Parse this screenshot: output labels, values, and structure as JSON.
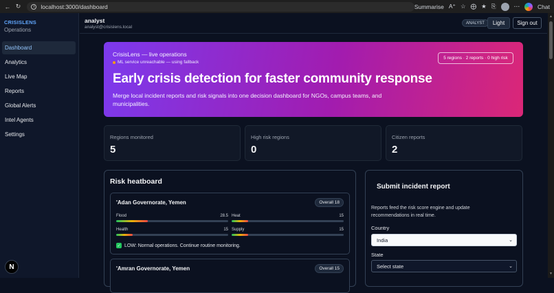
{
  "browser": {
    "url": "localhost:3000/dashboard",
    "summarise_label": "Summarise",
    "chat_label": "Chat"
  },
  "sidebar": {
    "brand": "CRISISLENS",
    "subtitle": "Operations",
    "items": [
      {
        "label": "Dashboard",
        "active": true
      },
      {
        "label": "Analytics"
      },
      {
        "label": "Live Map"
      },
      {
        "label": "Reports"
      },
      {
        "label": "Global Alerts"
      },
      {
        "label": "Intel Agents"
      },
      {
        "label": "Settings"
      }
    ],
    "badge": "N"
  },
  "topbar": {
    "user_name": "analyst",
    "user_email": "analyst@crisislens.local",
    "role": "ANALYST",
    "light_label": "Light",
    "signout_label": "Sign out"
  },
  "hero": {
    "kicker": "CrisisLens — live operations",
    "warning": "ML service unreachable — using fallback",
    "summary": "5 regions · 2 reports · 0 high risk",
    "title": "Early crisis detection for faster community response",
    "description": "Merge local incident reports and risk signals into one decision dashboard for NGOs, campus teams, and municipalities."
  },
  "stats": [
    {
      "label": "Regions monitored",
      "value": "5"
    },
    {
      "label": "High risk regions",
      "value": "0"
    },
    {
      "label": "Citizen reports",
      "value": "2"
    }
  ],
  "heatboard": {
    "title": "Risk heatboard",
    "regions": [
      {
        "name": "'Adan Governorate, Yemen",
        "overall": "Overall 18",
        "metrics": [
          {
            "label": "Flood",
            "value": "28.5",
            "fraction": 0.285
          },
          {
            "label": "Heat",
            "value": "15",
            "fraction": 0.15
          },
          {
            "label": "Health",
            "value": "15",
            "fraction": 0.15
          },
          {
            "label": "Supply",
            "value": "15",
            "fraction": 0.15
          }
        ],
        "status": "LOW: Normal operations. Continue routine monitoring."
      },
      {
        "name": "'Amran Governorate, Yemen",
        "overall": "Overall 15"
      }
    ]
  },
  "form": {
    "title": "Submit incident report",
    "description": "Reports feed the risk score engine and update recommendations in real time.",
    "country_label": "Country",
    "country_value": "India",
    "state_label": "State",
    "state_value": "Select state"
  }
}
